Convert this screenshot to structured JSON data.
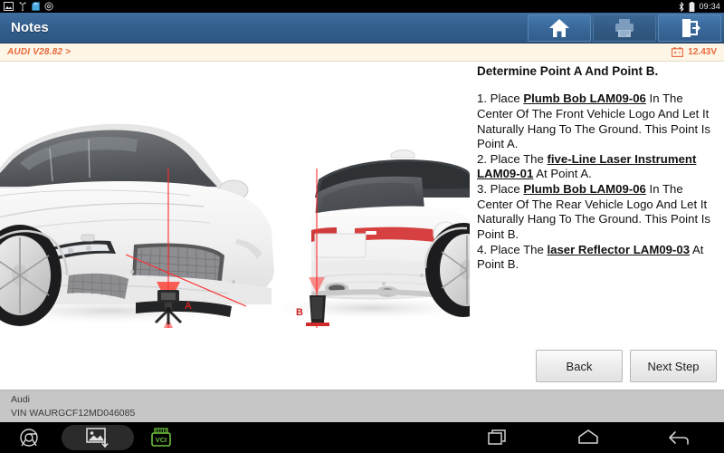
{
  "statusbar": {
    "icons": [
      "screenshot-icon",
      "usb-icon",
      "sdcard-icon",
      "settings-icon"
    ],
    "right_icons": [
      "bluetooth-icon",
      "battery-icon"
    ],
    "time": "09:34"
  },
  "titlebar": {
    "title": "Notes",
    "buttons": [
      {
        "name": "home-button",
        "icon": "home-icon",
        "enabled": true
      },
      {
        "name": "print-button",
        "icon": "printer-icon",
        "enabled": false
      },
      {
        "name": "exit-button",
        "icon": "exit-icon",
        "enabled": true
      }
    ]
  },
  "breadcrumb": {
    "path": "AUDI V28.82 >",
    "battery_icon": "battery-voltage-icon",
    "voltage": "12.43V"
  },
  "illustration": {
    "front_view": {
      "alt": "front three-quarter view of white SUV with plumb bob and five-line laser instrument",
      "point_label": "A"
    },
    "rear_view": {
      "alt": "rear three-quarter view of white SUV with laser reflector",
      "point_label": "B"
    },
    "laser_color": "#ff2d2d"
  },
  "note": {
    "heading": "Determine Point A And Point B.",
    "steps": [
      {
        "parts": [
          {
            "t": "1. Place ",
            "b": false
          },
          {
            "t": "Plumb Bob LAM09-06",
            "b": true
          },
          {
            "t": " In The Center Of The Front Vehicle Logo And Let It Naturally Hang To The Ground. This Point Is Point A.",
            "b": false
          }
        ]
      },
      {
        "parts": [
          {
            "t": "2. Place The ",
            "b": false
          },
          {
            "t": "five-Line Laser Instrument LAM09-01",
            "b": true
          },
          {
            "t": " At Point A.",
            "b": false
          }
        ]
      },
      {
        "parts": [
          {
            "t": "3. Place ",
            "b": false
          },
          {
            "t": "Plumb Bob LAM09-06",
            "b": true
          },
          {
            "t": " In The Center Of The Rear Vehicle Logo And Let It Naturally Hang To The Ground. This Point Is Point B.",
            "b": false
          }
        ]
      },
      {
        "parts": [
          {
            "t": "4. Place The ",
            "b": false
          },
          {
            "t": "laser Reflector LAM09-03",
            "b": true
          },
          {
            "t": " At Point B.",
            "b": false
          }
        ]
      }
    ]
  },
  "actions": {
    "back_label": "Back",
    "next_label": "Next Step"
  },
  "vehicle": {
    "make": "Audi",
    "vin": "VIN WAURGCF12MD046085"
  },
  "navbar": {
    "items": [
      {
        "name": "browser-button",
        "icon": "chrome-icon"
      },
      {
        "name": "screenshot-button",
        "icon": "screenshot-save-icon"
      },
      {
        "name": "vci-status-button",
        "icon": "vci-icon",
        "label": "VCI"
      },
      {
        "name": "recents-button",
        "icon": "recents-icon"
      },
      {
        "name": "home-button",
        "icon": "home-outline-icon"
      },
      {
        "name": "back-button",
        "icon": "back-arrow-icon"
      }
    ],
    "vci_label": "VCI",
    "vci_color": "#6dbf3c"
  }
}
